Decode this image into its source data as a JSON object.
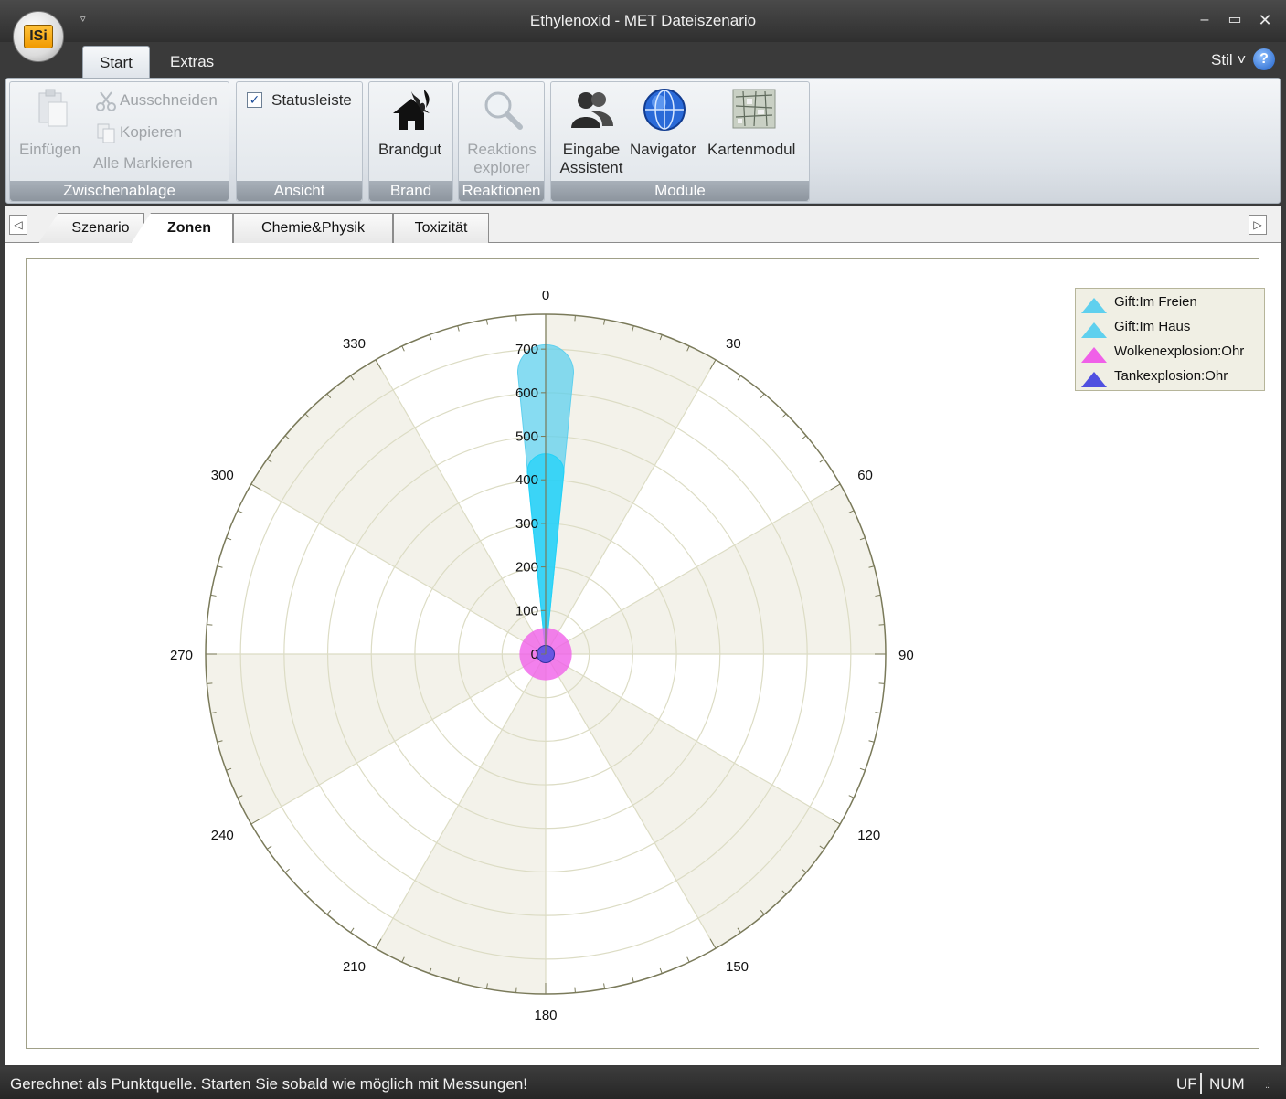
{
  "window": {
    "title": "Ethylenoxid - MET Dateiszenario",
    "logo_text": "ISi",
    "quick_access": "▿",
    "minimize": "–",
    "maximize": "▭",
    "close": "✕"
  },
  "ribbon_tabs": [
    {
      "label": "Start",
      "active": true
    },
    {
      "label": "Extras",
      "active": false
    }
  ],
  "style_menu": "Stil ˅",
  "help_label": "?",
  "ribbon": {
    "clipboard": {
      "paste": "Einfügen",
      "cut": "Ausschneiden",
      "copy": "Kopieren",
      "select_all": "Alle Markieren",
      "group": "Zwischenablage"
    },
    "view": {
      "statusbar": "Statusleiste",
      "statusbar_checked": true,
      "group": "Ansicht"
    },
    "fire": {
      "brandgut": "Brandgut",
      "group": "Brand"
    },
    "reactions": {
      "explorer_line1": "Reaktions",
      "explorer_line2": "explorer",
      "group": "Reaktionen"
    },
    "modules": {
      "assistant_line1": "Eingabe",
      "assistant_line2": "Assistent",
      "navigator": "Navigator",
      "map": "Kartenmodul",
      "group": "Module"
    }
  },
  "doc_tabs": [
    {
      "label": "Szenario",
      "active": false
    },
    {
      "label": "Zonen",
      "active": true
    },
    {
      "label": "Chemie&Physik",
      "active": false
    },
    {
      "label": "Toxizität",
      "active": false
    }
  ],
  "doc_tab_prev": "◁",
  "doc_tab_next": "▷",
  "legend": [
    {
      "label": "Gift:Im Freien",
      "color": "#5fd0ee"
    },
    {
      "label": "Gift:Im Haus",
      "color": "#5fd0ee"
    },
    {
      "label": "Wolkenexplosion:Ohr",
      "color": "#f060e8"
    },
    {
      "label": "Tankexplosion:Ohr",
      "color": "#5050e0"
    }
  ],
  "chart_data": {
    "type": "polar",
    "angle_ticks": [
      0,
      30,
      60,
      90,
      120,
      150,
      180,
      210,
      240,
      270,
      300,
      330
    ],
    "radial_ticks": [
      0,
      100,
      200,
      300,
      400,
      500,
      600,
      700
    ],
    "rmax": 780,
    "series": [
      {
        "name": "Gift:Im Freien",
        "color": "#5fd0ee",
        "shape": "drop",
        "direction_deg": 0,
        "length": 710,
        "width": 128
      },
      {
        "name": "Gift:Im Haus",
        "color": "#22d2f8",
        "shape": "drop",
        "direction_deg": 0,
        "length": 460,
        "width": 84
      },
      {
        "name": "Wolkenexplosion:Ohr",
        "color": "#f060e8",
        "shape": "circle",
        "radius": 60
      },
      {
        "name": "Tankexplosion:Ohr",
        "color": "#5050e0",
        "shape": "circle",
        "radius": 20
      }
    ]
  },
  "status": {
    "text": "Gerechnet als Punktquelle. Starten Sie sobald wie möglich mit Messungen!",
    "uf": "UF",
    "num": "NUM",
    "grip": ".:"
  }
}
